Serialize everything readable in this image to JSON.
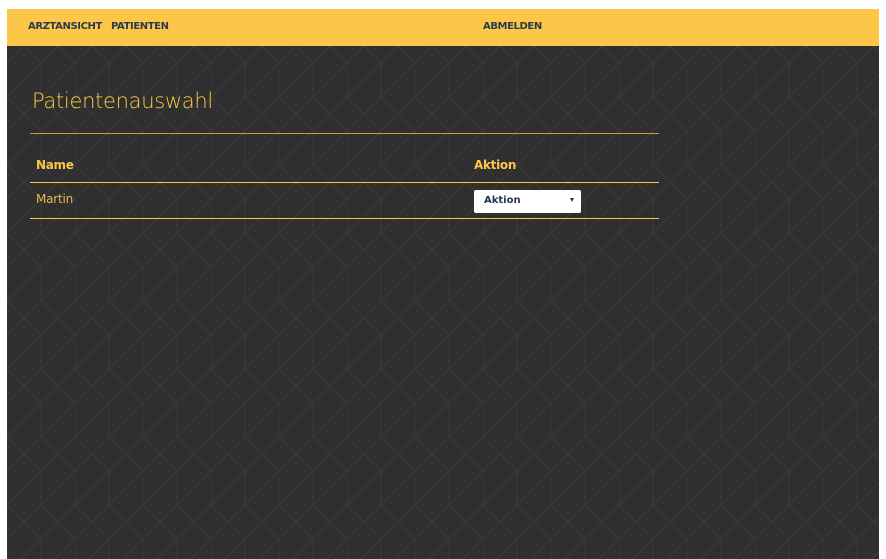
{
  "nav": {
    "arztansicht": "ARZTANSICHT",
    "patienten": "PATIENTEN",
    "abmelden": "ABMELDEN"
  },
  "page": {
    "title": "Patientenauswahl"
  },
  "table": {
    "headers": [
      "Name",
      "Aktion"
    ],
    "rows": [
      {
        "name": "Martin",
        "action": "Aktion"
      }
    ]
  },
  "colors": {
    "accent": "#fcc748",
    "background": "#2f2f2f",
    "nav_text": "#2b3a4f"
  },
  "icons": {
    "select_arrow": "chevron-down-icon"
  }
}
